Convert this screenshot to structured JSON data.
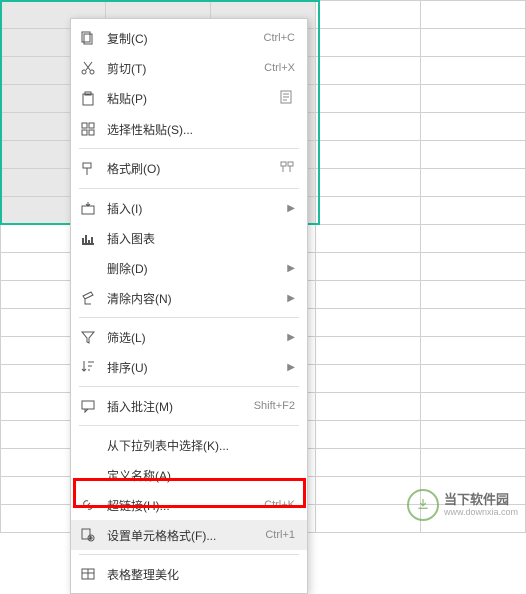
{
  "menu": {
    "copy": {
      "label": "复制(C)",
      "shortcut": "Ctrl+C"
    },
    "cut": {
      "label": "剪切(T)",
      "shortcut": "Ctrl+X"
    },
    "paste": {
      "label": "粘贴(P)"
    },
    "paste_special": {
      "label": "选择性粘贴(S)..."
    },
    "format_painter": {
      "label": "格式刷(O)"
    },
    "insert": {
      "label": "插入(I)"
    },
    "insert_chart": {
      "label": "插入图表"
    },
    "delete": {
      "label": "删除(D)"
    },
    "clear_content": {
      "label": "清除内容(N)"
    },
    "filter": {
      "label": "筛选(L)"
    },
    "sort": {
      "label": "排序(U)"
    },
    "insert_comment": {
      "label": "插入批注(M)",
      "shortcut": "Shift+F2"
    },
    "select_from_dropdown": {
      "label": "从下拉列表中选择(K)..."
    },
    "define_name": {
      "label": "定义名称(A)..."
    },
    "hyperlink": {
      "label": "超链接(H)...",
      "shortcut": "Ctrl+K"
    },
    "format_cells": {
      "label": "设置单元格格式(F)...",
      "shortcut": "Ctrl+1"
    },
    "table_format": {
      "label": "表格整理美化"
    }
  },
  "watermark": {
    "cn": "当下软件园",
    "en": "www.downxia.com"
  }
}
